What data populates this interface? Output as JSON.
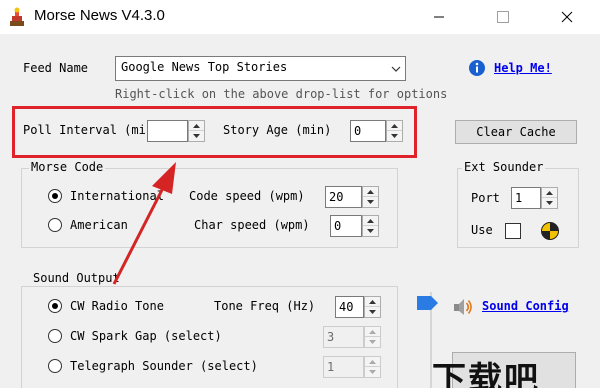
{
  "window": {
    "title": "Morse News V4.3.0"
  },
  "feed": {
    "label": "Feed Name",
    "selected": "Google News Top Stories",
    "hint": "Right-click on the above drop-list for options",
    "help_label": "Help Me!"
  },
  "poll": {
    "label": "Poll Interval (min)",
    "value": ""
  },
  "story_age": {
    "label": "Story Age (min)",
    "value": "0"
  },
  "clear_cache_label": "Clear Cache",
  "morse_code": {
    "title": "Morse Code",
    "options": [
      "International",
      "American"
    ],
    "selected_index": 0,
    "code_speed_label": "Code speed (wpm)",
    "code_speed_value": "20",
    "char_speed_label": "Char speed (wpm)",
    "char_speed_value": "0"
  },
  "ext_sounder": {
    "title": "Ext Sounder",
    "port_label": "Port",
    "port_value": "1",
    "use_label": "Use"
  },
  "sound_output": {
    "title": "Sound Output",
    "options": [
      "CW Radio Tone",
      "CW Spark Gap (select)",
      "Telegraph Sounder (select)"
    ],
    "selected_index": 0,
    "tone_freq_label": "Tone Freq (Hz)",
    "tone_freq_value": "40",
    "spark_value": "3",
    "sounder_value": "1"
  },
  "sound_config_label": "Sound Config",
  "watermark": "下载吧",
  "colors": {
    "highlight": "#e0222a",
    "arrow": "#d42424",
    "link": "#0000ee"
  }
}
